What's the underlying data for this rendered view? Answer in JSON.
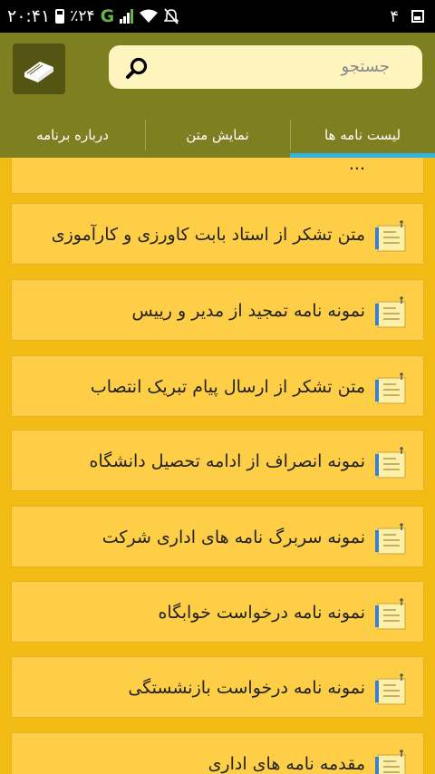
{
  "status_bar": {
    "time": "۲۰:۴۱",
    "battery_percent": "٪۲۴",
    "network": "G",
    "notification_count": "۴",
    "icons": [
      "battery-icon",
      "signal-icon",
      "wifi-icon",
      "mute-icon",
      "image-notification-icon"
    ]
  },
  "header": {
    "app_icon": "book-icon",
    "search_placeholder": "جستجو"
  },
  "tabs": [
    {
      "label": "لیست نامه ها",
      "active": true
    },
    {
      "label": "نمایش متن",
      "active": false
    },
    {
      "label": "درباره برنامه",
      "active": false
    }
  ],
  "list": {
    "items": [
      {
        "label": "..."
      },
      {
        "label": "متن تشکر از استاد بابت کاورزی و کارآموزی"
      },
      {
        "label": "نمونه نامه تمجید از مدیر و رییس"
      },
      {
        "label": "متن تشکر از ارسال پیام تبریک انتصاب"
      },
      {
        "label": "نمونه انصراف از ادامه تحصیل دانشگاه"
      },
      {
        "label": "نمونه سربرگ نامه های اداری شرکت"
      },
      {
        "label": "نمونه نامه درخواست خوابگاه"
      },
      {
        "label": "نمونه نامه درخواست بازنشستگی"
      },
      {
        "label": "مقدمه نامه های اداری"
      }
    ]
  },
  "colors": {
    "background": "#F2BC14",
    "header": "#7E7F20",
    "item": "#FECE46",
    "tab_indicator": "#33B3E4",
    "search_field": "#FEF4BE"
  }
}
